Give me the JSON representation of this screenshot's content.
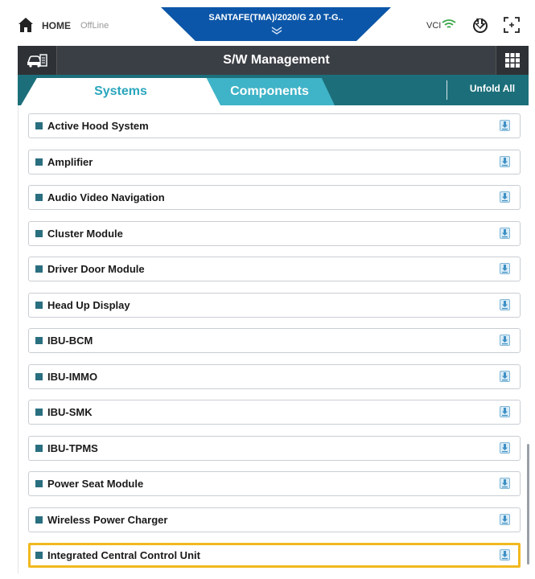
{
  "header": {
    "home_label": "HOME",
    "status_label": "OffLine",
    "vehicle_title": "SANTAFE(TMA)/2020/G 2.0 T-G..",
    "vci_label": "VCI"
  },
  "titlebar": {
    "title": "S/W Management"
  },
  "tabs": {
    "systems": "Systems",
    "components": "Components",
    "unfold_all": "Unfold All",
    "active": "Systems"
  },
  "list": {
    "items": [
      "Active Hood System",
      "Amplifier",
      "Audio Video Navigation",
      "Cluster Module",
      "Driver Door Module",
      "Head Up Display",
      "IBU-BCM",
      "IBU-IMMO",
      "IBU-SMK",
      "IBU-TPMS",
      "Power Seat Module",
      "Wireless Power Charger",
      "Integrated Central Control Unit"
    ],
    "highlighted_item": "Integrated Central Control Unit"
  },
  "colors": {
    "vehicle_tab": "#0b56a8",
    "titlebar": "#3a3f45",
    "tabsbar": "#1c6f7a",
    "tab_active_text": "#2aa6bd",
    "tab_inactive_bg": "#3fb3c7",
    "bullet": "#2a6f80",
    "highlight": "#f1b91f"
  },
  "icons": {
    "home": "home-icon",
    "wifi": "wifi-icon",
    "vci_connect": "vci-connect-icon",
    "screen_capture": "screen-capture-icon",
    "vehicle_info": "vehicle-info-icon",
    "grid_menu": "grid-menu-icon",
    "download": "download-icon"
  }
}
